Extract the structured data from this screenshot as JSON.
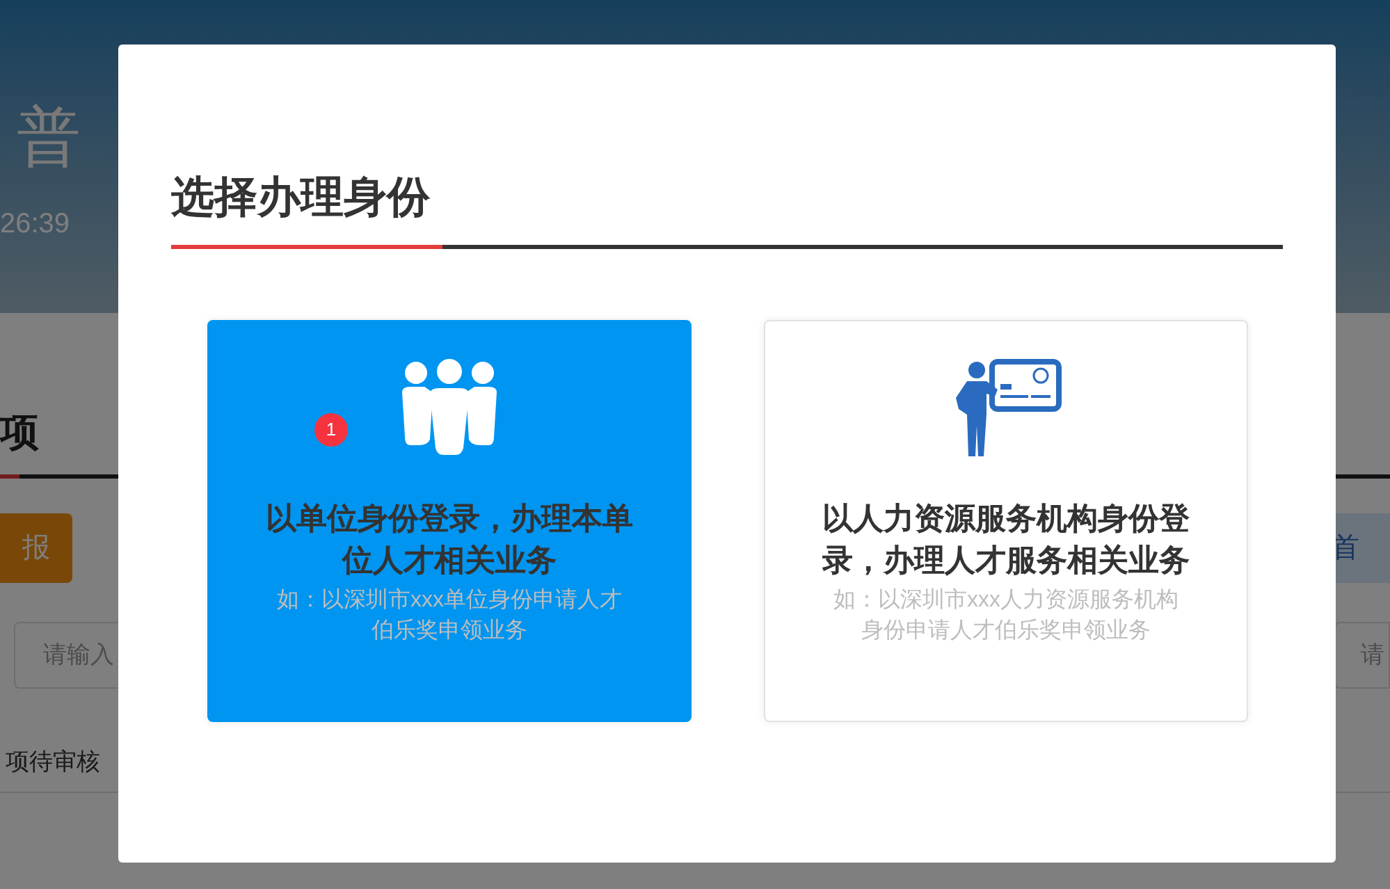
{
  "background_page": {
    "header_title": "普",
    "header_time": "26:39",
    "section_title": "项",
    "apply_button": "报",
    "search_placeholder": "请输入",
    "right_button": "首",
    "right_search_placeholder": "请",
    "status_text": "项待审核"
  },
  "dialog": {
    "title": "选择办理身份",
    "options": [
      {
        "kind": "unit",
        "title": "以单位身份登录，办理本单位人才相关业务",
        "example": "如：以深圳市xxx单位身份申请人才伯乐奖申领业务",
        "selected": true,
        "badge": "1"
      },
      {
        "kind": "agency",
        "title": "以人力资源服务机构身份登录，办理人才服务相关业务",
        "example": "如：以深圳市xxx人力资源服务机构身份申请人才伯乐奖申领业务",
        "selected": false
      }
    ]
  }
}
